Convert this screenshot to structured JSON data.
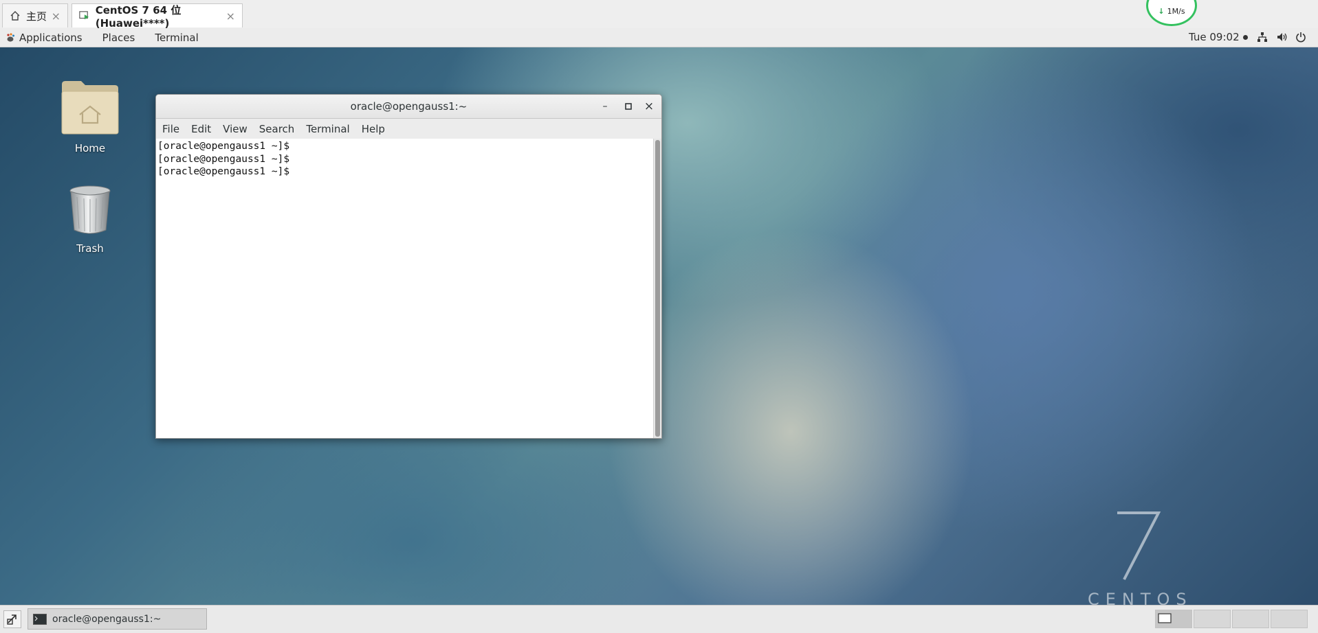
{
  "vm_tabs": [
    {
      "label": "主页",
      "icon": "home-icon"
    },
    {
      "label": "CentOS 7 64 位(Huawei****)",
      "icon": "vm-play-icon"
    }
  ],
  "net_speed": "1M/s",
  "top_panel": {
    "applications": "Applications",
    "places": "Places",
    "terminal": "Terminal",
    "clock": "Tue 09:02"
  },
  "desktop": {
    "icons": [
      {
        "label": "Home"
      },
      {
        "label": "Trash"
      }
    ],
    "watermark_number": "7",
    "watermark_text": "CENTOS"
  },
  "terminal": {
    "title": "oracle@opengauss1:~",
    "menu": [
      "File",
      "Edit",
      "View",
      "Search",
      "Terminal",
      "Help"
    ],
    "lines": [
      "[oracle@opengauss1 ~]$",
      "[oracle@opengauss1 ~]$",
      "[oracle@opengauss1 ~]$"
    ]
  },
  "taskbar": {
    "window_label": "oracle@opengauss1:~",
    "workspaces": 4,
    "active_workspace": 1
  }
}
